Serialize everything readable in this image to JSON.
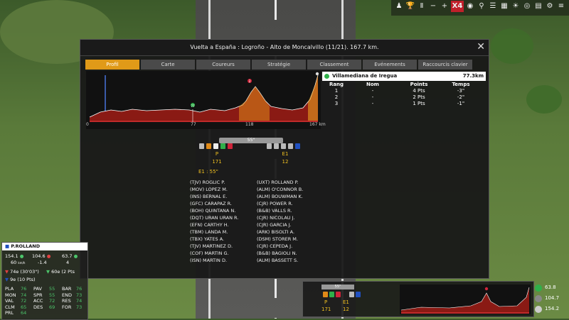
{
  "window": {
    "title": "Vuelta a España : Logroño - Alto de Moncalvillo (11/21). 167.7 km."
  },
  "tabs": [
    "Profil",
    "Carte",
    "Coureurs",
    "Stratégie",
    "Classement",
    "Evénements",
    "Raccourcis clavier"
  ],
  "profile": {
    "km_labels": [
      "0",
      "77",
      "118",
      "167 km"
    ],
    "sprint_marker": "77",
    "climb_marker": "2"
  },
  "sprint": {
    "name": "Villamediana de Iregua",
    "km": "77.3km",
    "headers": [
      "Rang",
      "Nom",
      "Points",
      "Temps"
    ],
    "rows": [
      [
        "1",
        "-",
        "4 Pts",
        "-3\""
      ],
      [
        "2",
        "-",
        "2 Pts",
        "-2\""
      ],
      [
        "3",
        "-",
        "1 Pts",
        "-1\""
      ]
    ]
  },
  "race": {
    "gap": "55\"",
    "peloton_label": "P",
    "peloton_count": "171",
    "echappee_label": "E1",
    "echappee_count": "12",
    "ecart": "E1 : 55\"",
    "peloton_riders": [
      "(TJV) ROGLIC P.",
      "(MOV) LOPEZ M.",
      "(INS) BERNAL E.",
      "(GFC) CARAPAZ R.",
      "(BOH) QUINTANA N.",
      "(DQT) URAN URAN R.",
      "(EFN) CARTHY H.",
      "(TBM) LANDA M.",
      "(TBX) YATES A.",
      "(TJV) MARTINEZ D.",
      "(COF) MARTIN G.",
      "(ISN) MARTIN D."
    ],
    "breakaway_riders": [
      "(UXT) ROLLAND P.",
      "(ALM) O'CONNOR B.",
      "(ALM) BOUWMAN K.",
      "(CJR) POWER R.",
      "(B&B) VALLS R.",
      "(CJR) NICOLAU J.",
      "(CJR) GARCIA J.",
      "(ARK) BISOLTI A.",
      "(DSM) STORER M.",
      "(CJR) CEPEDA J.",
      "(B&B) BAGIOLI N.",
      "(ALM) BASSETT S."
    ]
  },
  "rider": {
    "name": "P.ROLLAND",
    "v1": "154.1",
    "v2": "104.6",
    "v3": "63.7",
    "v4": "60",
    "unit": "km/h",
    "v5": "-1.4",
    "v6": "4",
    "rank1": "74e (30'03\")",
    "rank2": "60e (2 Pts",
    "rank3": "9e (10 Pts)",
    "attrs": [
      [
        "PLA",
        "76"
      ],
      [
        "PAV",
        "55"
      ],
      [
        "BAR",
        "76"
      ],
      [
        "MON",
        "74"
      ],
      [
        "SPR",
        "55"
      ],
      [
        "END",
        "73"
      ],
      [
        "VAL",
        "72"
      ],
      [
        "ACC",
        "72"
      ],
      [
        "RES",
        "74"
      ],
      [
        "CLM",
        "65"
      ],
      [
        "DES",
        "69"
      ],
      [
        "FOR",
        "73"
      ],
      [
        "PRL",
        "64"
      ]
    ]
  },
  "mini": {
    "gap": "55\"",
    "p_label": "P",
    "p_count": "171",
    "e_label": "E1",
    "e_count": "12"
  },
  "stats": [
    "63.8",
    "104.7",
    "154.2"
  ]
}
